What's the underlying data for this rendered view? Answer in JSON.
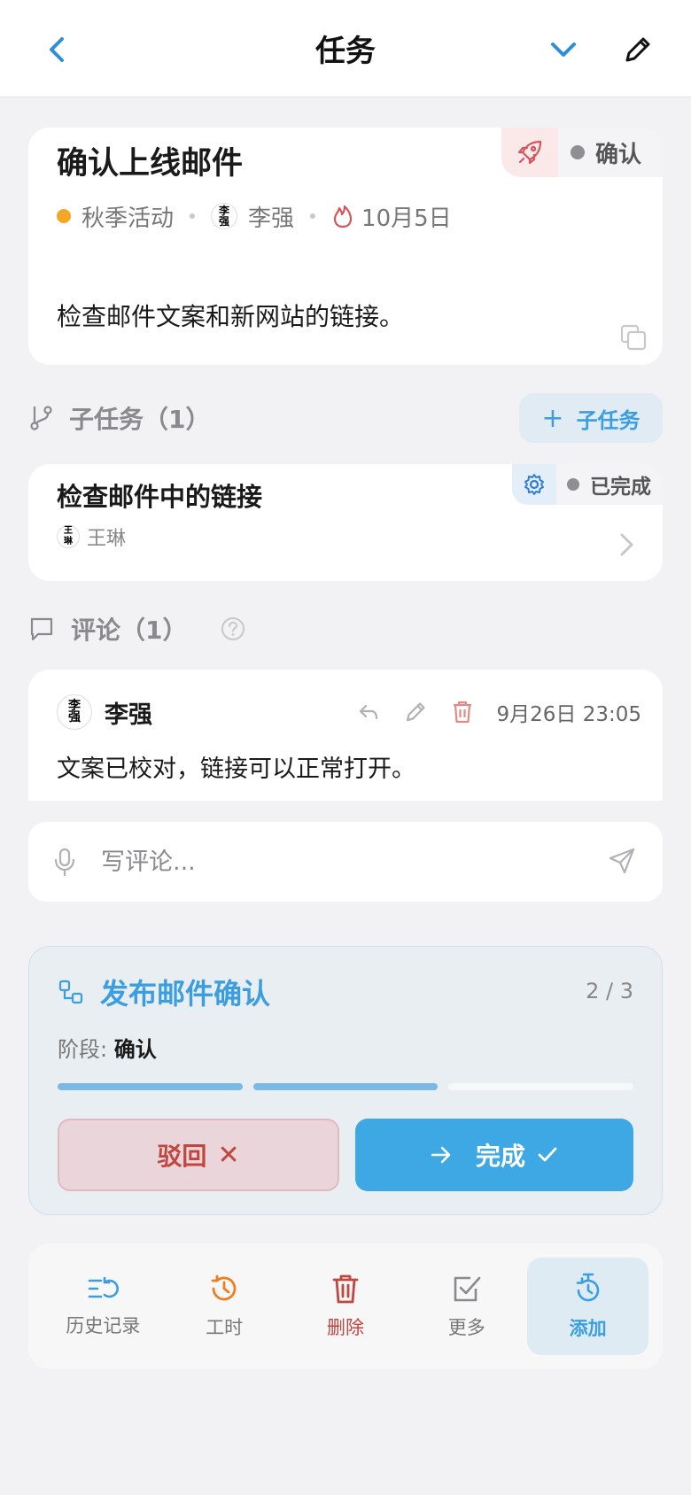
{
  "header": {
    "title": "任务"
  },
  "task": {
    "title": "确认上线邮件",
    "status": "确认",
    "project": "秋季活动",
    "assignee": "李强",
    "assignee_avatar": "李强",
    "due_date": "10月5日",
    "description": "检查邮件文案和新网站的链接。"
  },
  "subtasks": {
    "heading": "子任务（1）",
    "add_label": "子任务",
    "items": [
      {
        "title": "检查邮件中的链接",
        "status": "已完成",
        "assignee": "王琳",
        "assignee_avatar": "王琳"
      }
    ]
  },
  "comments": {
    "heading": "评论（1）",
    "items": [
      {
        "author": "李强",
        "avatar": "李强",
        "time": "9月26日 23:05",
        "text": "文案已校对，链接可以正常打开。"
      }
    ],
    "input_placeholder": "写评论..."
  },
  "workflow": {
    "title": "发布邮件确认",
    "count": "2 / 3",
    "stage_label": "阶段: ",
    "stage_value": "确认",
    "progress": {
      "completed": 2,
      "total": 3
    },
    "reject_label": "驳回",
    "done_label": "完成"
  },
  "toolbar": {
    "items": [
      {
        "label": "历史记录"
      },
      {
        "label": "工时"
      },
      {
        "label": "删除"
      },
      {
        "label": "更多"
      },
      {
        "label": "添加"
      }
    ]
  },
  "colors": {
    "accent": "#3ea8e5",
    "danger": "#c0463f",
    "project_dot": "#f5a623",
    "background": "#f2f2f4"
  }
}
